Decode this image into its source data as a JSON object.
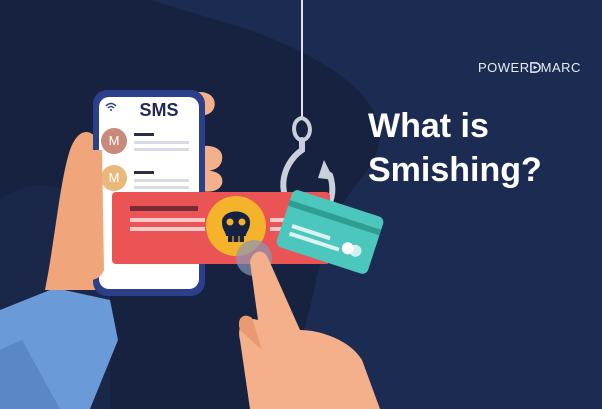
{
  "brand": {
    "name_part1": "POWER",
    "name_part2": "MARC"
  },
  "headline": {
    "line1": "What is",
    "line2": "Smishing?"
  },
  "phone": {
    "app_title": "SMS",
    "messages": [
      {
        "avatar_letter": "M",
        "avatar_color": "#c98a7c"
      },
      {
        "avatar_letter": "M",
        "avatar_color": "#e8b97a"
      }
    ]
  },
  "colors": {
    "background": "#16223f",
    "background_shape": "#1c2b52",
    "accent_red": "#ea5455",
    "card_teal": "#4cc7bd",
    "skull_yellow": "#f5b32b"
  },
  "icons": [
    "fishing-hook-icon",
    "skull-icon",
    "wifi-icon",
    "credit-card-icon"
  ]
}
